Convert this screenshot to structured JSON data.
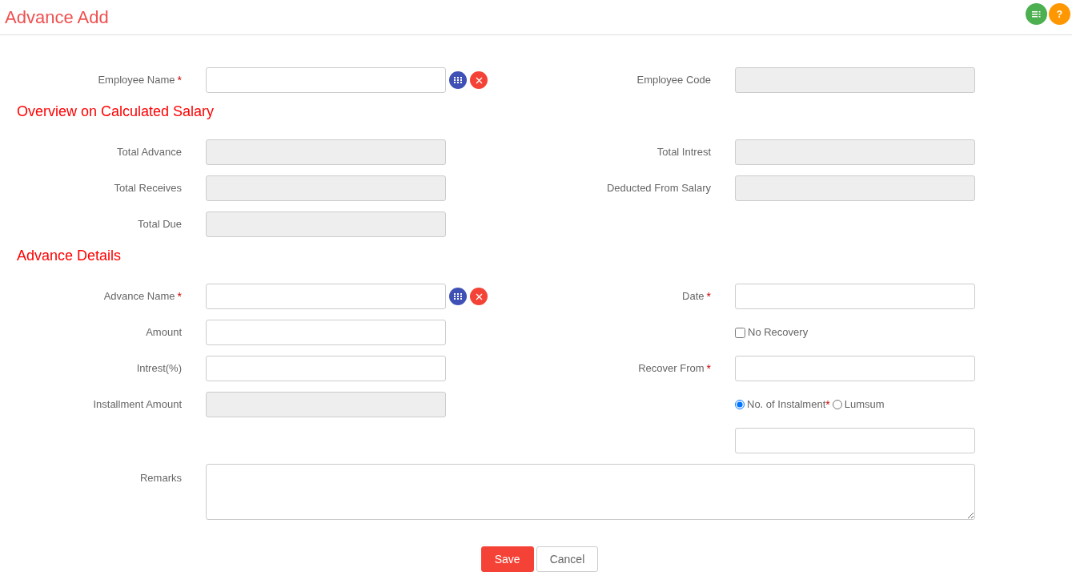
{
  "title": "Advance Add",
  "header_buttons": [
    {
      "kind": "list"
    },
    {
      "kind": "help",
      "label": "?"
    }
  ],
  "top_rows": [
    {
      "left": {
        "kind": "lookup",
        "label": "Employee Name",
        "marker": "*"
      },
      "right": {
        "kind": "readonly",
        "label": "Employee Code"
      }
    }
  ],
  "sections": [
    {
      "heading": "Overview on Calculated Salary",
      "rows": [
        {
          "left": {
            "kind": "readonly",
            "label": "Total Advance"
          },
          "right": {
            "kind": "readonly",
            "label": "Total Intrest"
          }
        },
        {
          "left": {
            "kind": "readonly",
            "label": "Total Receives"
          },
          "right": {
            "kind": "readonly",
            "label": "Deducted From Salary"
          }
        },
        {
          "left": {
            "kind": "readonly",
            "label": "Total Due"
          },
          "right": null
        }
      ]
    },
    {
      "heading": "Advance Details",
      "rows": [
        {
          "left": {
            "kind": "lookup",
            "label": "Advance Name",
            "marker": "*"
          },
          "right": {
            "kind": "text",
            "label": "Date",
            "marker": "*"
          }
        },
        {
          "left": {
            "kind": "text",
            "label": "Amount"
          },
          "right": {
            "kind": "checkbox",
            "option": "No Recovery",
            "checked": false
          }
        },
        {
          "left": {
            "kind": "text",
            "label": "Intrest(%)"
          },
          "right": {
            "kind": "text",
            "label": "Recover From",
            "marker": "*"
          }
        },
        {
          "left": {
            "kind": "readonly",
            "label": "Installment Amount"
          },
          "right": {
            "kind": "radio",
            "options": [
              {
                "label": "No. of Instalment",
                "marker": "*",
                "selected": true
              },
              {
                "label": "Lumsum",
                "selected": false
              }
            ]
          }
        },
        {
          "left": null,
          "right": {
            "kind": "text"
          }
        }
      ]
    }
  ],
  "remarks": {
    "label": "Remarks"
  },
  "buttons": [
    {
      "kind": "primary",
      "label": "Save"
    },
    {
      "kind": "default",
      "label": "Cancel"
    }
  ]
}
